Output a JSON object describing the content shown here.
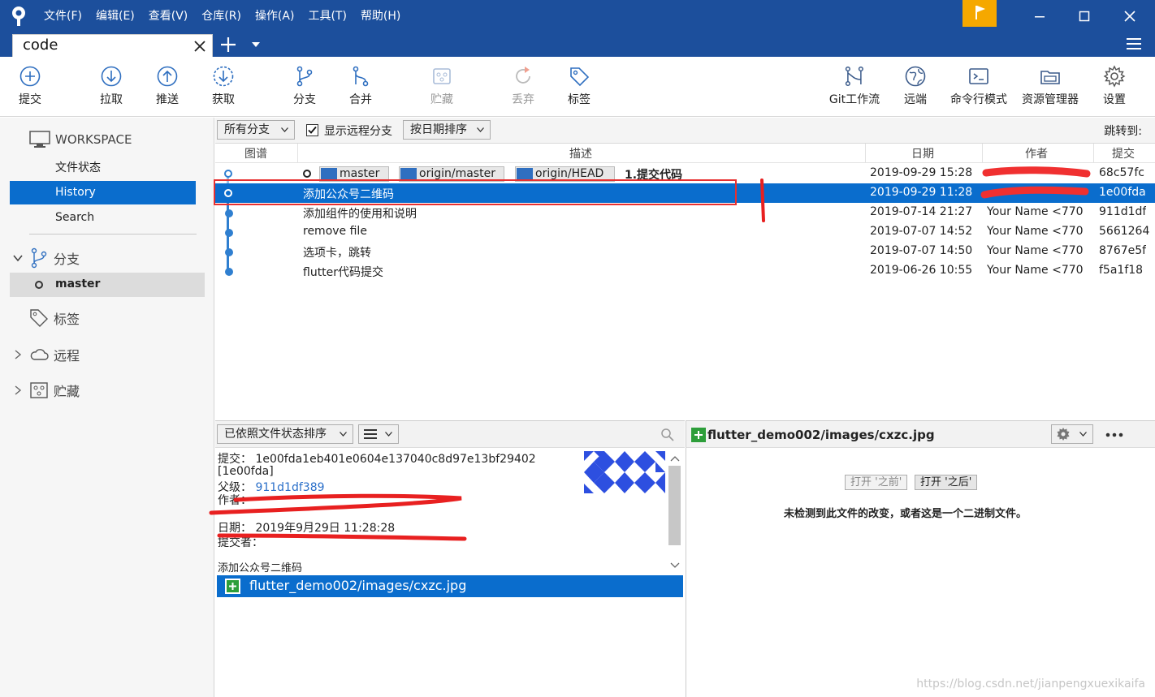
{
  "menu": [
    "文件(F)",
    "编辑(E)",
    "查看(V)",
    "仓库(R)",
    "操作(A)",
    "工具(T)",
    "帮助(H)"
  ],
  "tab": {
    "label": "code"
  },
  "toolbar": {
    "commit": "提交",
    "pull": "拉取",
    "push": "推送",
    "fetch": "获取",
    "branch": "分支",
    "merge": "合并",
    "stash": "贮藏",
    "discard": "丢弃",
    "tag": "标签",
    "gitflow": "Git工作流",
    "remote": "远端",
    "terminal": "命令行模式",
    "explorer": "资源管理器",
    "settings": "设置"
  },
  "sidebar": {
    "workspace": "WORKSPACE",
    "items": [
      "文件状态",
      "History",
      "Search"
    ],
    "branches": "分支",
    "branch_current": "master",
    "tags": "标签",
    "remotes": "远程",
    "stashes": "贮藏"
  },
  "filter": {
    "branches_select": "所有分支",
    "show_remote": "显示远程分支",
    "sort_select": "按日期排序",
    "jump_to": "跳转到:"
  },
  "table": {
    "headers": {
      "graph": "图谱",
      "desc": "描述",
      "date": "日期",
      "author": "作者",
      "commit": "提交"
    },
    "refs": [
      "master",
      "origin/master",
      "origin/HEAD"
    ],
    "rows": [
      {
        "desc": "1.提交代码",
        "date": "2019-09-29 15:28",
        "author": "",
        "hash": "68c57fc"
      },
      {
        "desc": "添加公众号二维码",
        "date": "2019-09-29 11:28",
        "author": "",
        "hash": "1e00fda"
      },
      {
        "desc": "添加组件的使用和说明",
        "date": "2019-07-14 21:27",
        "author": "Your Name <770",
        "hash": "911d1df"
      },
      {
        "desc": "remove file",
        "date": "2019-07-07 14:52",
        "author": "Your Name <770",
        "hash": "5661264"
      },
      {
        "desc": "选项卡，跳转",
        "date": "2019-07-07 14:50",
        "author": "Your Name <770",
        "hash": "8767e5f"
      },
      {
        "desc": "flutter代码提交",
        "date": "2019-06-26 10:55",
        "author": "Your Name <770",
        "hash": "f5a1f18"
      }
    ]
  },
  "files_bar": {
    "sort_select": "已依照文件状态排序"
  },
  "details": {
    "commit_label": "提交：",
    "commit_hash": "1e00fda1eb401e0604e137040c8d97e13bf29402",
    "short_hash": "[1e00fda]",
    "parent_label": "父级：",
    "parent_hash": "911d1df389",
    "author_label": "作者：",
    "date_label": "日期：",
    "date_value": "2019年9月29日 11:28:28",
    "committer_label": "提交者：",
    "message": "添加公众号二维码"
  },
  "file_list": [
    "flutter_demo002/images/cxzc.jpg"
  ],
  "diff": {
    "path": "flutter_demo002/images/cxzc.jpg",
    "open_before": "打开 '之前'",
    "open_after": "打开 '之后'",
    "no_change": "未检测到此文件的改变，或者这是一个二进制文件。"
  },
  "watermark": "https://blog.csdn.net/jianpengxuexikaifa"
}
